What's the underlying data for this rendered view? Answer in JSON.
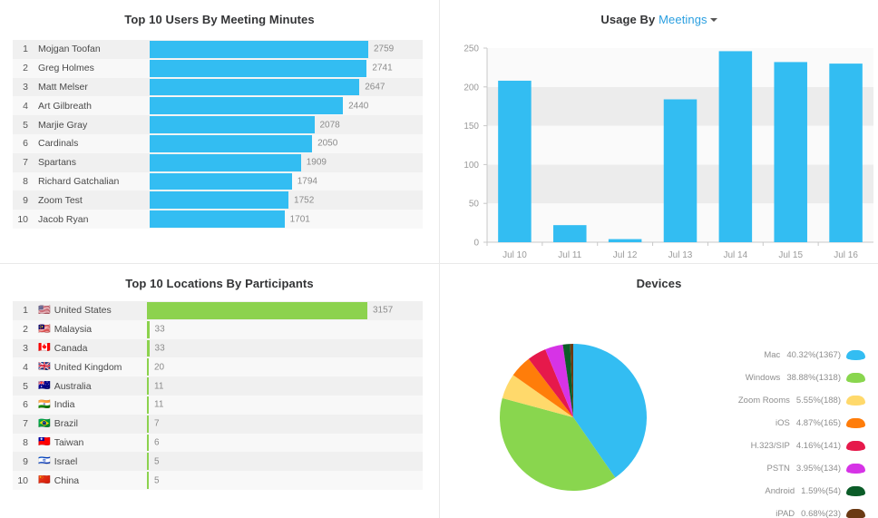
{
  "panels": {
    "users": {
      "title": "Top 10 Users By Meeting Minutes"
    },
    "usage": {
      "title_prefix": "Usage By",
      "title_link": "Meetings",
      "caret_icon": "chevron-down-icon"
    },
    "locations": {
      "title": "Top 10 Locations By Participants"
    },
    "devices": {
      "title": "Devices"
    }
  },
  "colors": {
    "bar_blue": "#33bdf2",
    "bar_green": "#8cd24e",
    "link_blue": "#2a9fe0",
    "row_odd": "#f0f0f0",
    "row_even": "#f8f8f8",
    "value_text": "#8b8b8b"
  },
  "chart_data": [
    {
      "type": "bar",
      "title": "Top 10 Users By Meeting Minutes",
      "orientation": "horizontal",
      "xlabel": "",
      "ylabel": "",
      "grid": false,
      "legend": "none",
      "max_value": 2759,
      "categories": [
        "Mojgan Toofan",
        "Greg Holmes",
        "Matt Melser",
        "Art Gilbreath",
        "Marjie Gray",
        "Cardinals",
        "Spartans",
        "Richard Gatchalian",
        "Zoom Test",
        "Jacob Ryan"
      ],
      "ranks": [
        1,
        2,
        3,
        4,
        5,
        6,
        7,
        8,
        9,
        10
      ],
      "values": [
        2759,
        2741,
        2647,
        2440,
        2078,
        2050,
        1909,
        1794,
        1752,
        1701
      ],
      "value_labels": [
        "2759",
        "2741",
        "2647",
        "2440",
        "2078",
        "2050",
        "1909",
        "1794",
        "1752",
        "1701"
      ],
      "series_color": "#33bdf2"
    },
    {
      "type": "bar",
      "title": "Usage By Meetings",
      "orientation": "vertical",
      "categories": [
        "Jul 10",
        "Jul 11",
        "Jul 12",
        "Jul 13",
        "Jul 14",
        "Jul 15",
        "Jul 16"
      ],
      "values": [
        208,
        22,
        4,
        184,
        246,
        232,
        230
      ],
      "ylim": [
        0,
        250
      ],
      "yticks": [
        0,
        50,
        100,
        150,
        200,
        250
      ],
      "ytick_labels": [
        "0",
        "50",
        "100",
        "150",
        "200",
        "250"
      ],
      "xlabel": "",
      "ylabel": "",
      "grid": "banded",
      "legend": "none",
      "series_color": "#33bdf2"
    },
    {
      "type": "bar",
      "title": "Top 10 Locations By Participants",
      "orientation": "horizontal",
      "xlabel": "",
      "ylabel": "",
      "grid": false,
      "legend": "none",
      "max_value": 3157,
      "ranks": [
        1,
        2,
        3,
        4,
        5,
        6,
        7,
        8,
        9,
        10
      ],
      "categories": [
        "United States",
        "Malaysia",
        "Canada",
        "United Kingdom",
        "Australia",
        "India",
        "Brazil",
        "Taiwan",
        "Israel",
        "China"
      ],
      "flags": [
        "🇺🇸",
        "🇲🇾",
        "🇨🇦",
        "🇬🇧",
        "🇦🇺",
        "🇮🇳",
        "🇧🇷",
        "🇹🇼",
        "🇮🇱",
        "🇨🇳"
      ],
      "values": [
        3157,
        33,
        33,
        20,
        11,
        11,
        7,
        6,
        5,
        5
      ],
      "value_labels": [
        "3157",
        "33",
        "33",
        "20",
        "11",
        "11",
        "7",
        "6",
        "5",
        "5"
      ],
      "series_color": "#8cd24e"
    },
    {
      "type": "pie",
      "title": "Devices",
      "legend": "right",
      "start_angle_deg": 0,
      "direction": "clockwise",
      "labels": [
        "Mac",
        "Windows",
        "Zoom Rooms",
        "iOS",
        "H.323/SIP",
        "PSTN",
        "Android",
        "iPAD"
      ],
      "percents": [
        40.32,
        38.88,
        5.55,
        4.87,
        4.16,
        3.95,
        1.59,
        0.68
      ],
      "counts": [
        1367,
        1318,
        188,
        165,
        141,
        134,
        54,
        23
      ],
      "legend_values": [
        "40.32%(1367)",
        "38.88%(1318)",
        "5.55%(188)",
        "4.87%(165)",
        "4.16%(141)",
        "3.95%(134)",
        "1.59%(54)",
        "0.68%(23)"
      ],
      "colors": [
        "#33bdf2",
        "#89d64e",
        "#ffd96b",
        "#ff7d0a",
        "#e6194b",
        "#d633e6",
        "#0b5c28",
        "#6b3a14"
      ]
    }
  ]
}
